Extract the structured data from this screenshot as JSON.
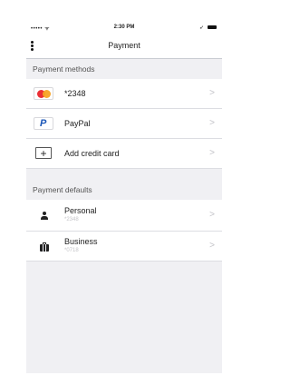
{
  "status_bar": {
    "signal": "••••• ᯤ",
    "time": "2:30 PM",
    "location": "➶"
  },
  "navbar": {
    "title": "Payment"
  },
  "payment_methods": {
    "header": "Payment methods",
    "items": [
      {
        "label": "*2348",
        "icon": "mastercard-icon"
      },
      {
        "label": "PayPal",
        "icon": "paypal-icon"
      },
      {
        "label": "Add credit card",
        "icon": "plus-icon"
      }
    ]
  },
  "payment_defaults": {
    "header": "Payment defaults",
    "items": [
      {
        "label": "Personal",
        "sub": "*2348",
        "icon": "person-icon"
      },
      {
        "label": "Business",
        "sub": "*0718",
        "icon": "briefcase-icon"
      }
    ]
  },
  "colors": {
    "mastercard_red": "#eb2f35",
    "mastercard_orange": "#f7a324",
    "paypal_blue": "#1a56b8",
    "background": "#f0f0f3"
  }
}
